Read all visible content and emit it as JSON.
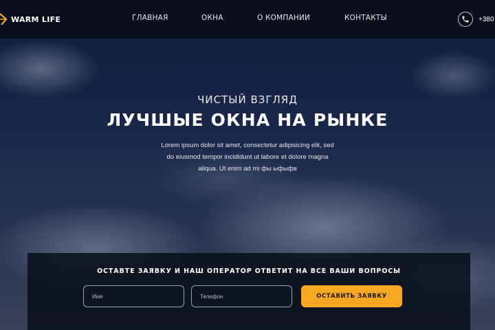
{
  "brand": {
    "name": "WARM LIFE",
    "accent_color": "#f6a623"
  },
  "nav": {
    "items": [
      {
        "label": "ГЛАВНАЯ"
      },
      {
        "label": "ОКНА"
      },
      {
        "label": "О КОМПАНИИ"
      },
      {
        "label": "КОНТАКТЫ"
      }
    ]
  },
  "contact": {
    "phone_icon": "phone-icon",
    "phone_text": "+380"
  },
  "hero": {
    "kicker": "ЧИСТЫЙ ВЗГЛЯД",
    "headline": "ЛУЧШЫЕ ОКНА НА РЫНКЕ",
    "description_lines": [
      "Lorem ipsum dolor sit amet, consectetur adipisicing elit, sed",
      "do eiusmod tempor incididunt ut labore et dolore magna",
      "aliqua. Ut enim ad mi фы ыфыфв"
    ]
  },
  "request_form": {
    "title": "ОСТАВТЕ ЗАЯВКУ И НАШ ОПЕРАТОР ОТВЕТИТ НА ВСЕ ВАШИ ВОПРОСЫ",
    "name_placeholder": "Имя",
    "phone_placeholder": "Телефон",
    "submit_label": "ОСТАВИТЬ ЗАЯВКУ"
  }
}
